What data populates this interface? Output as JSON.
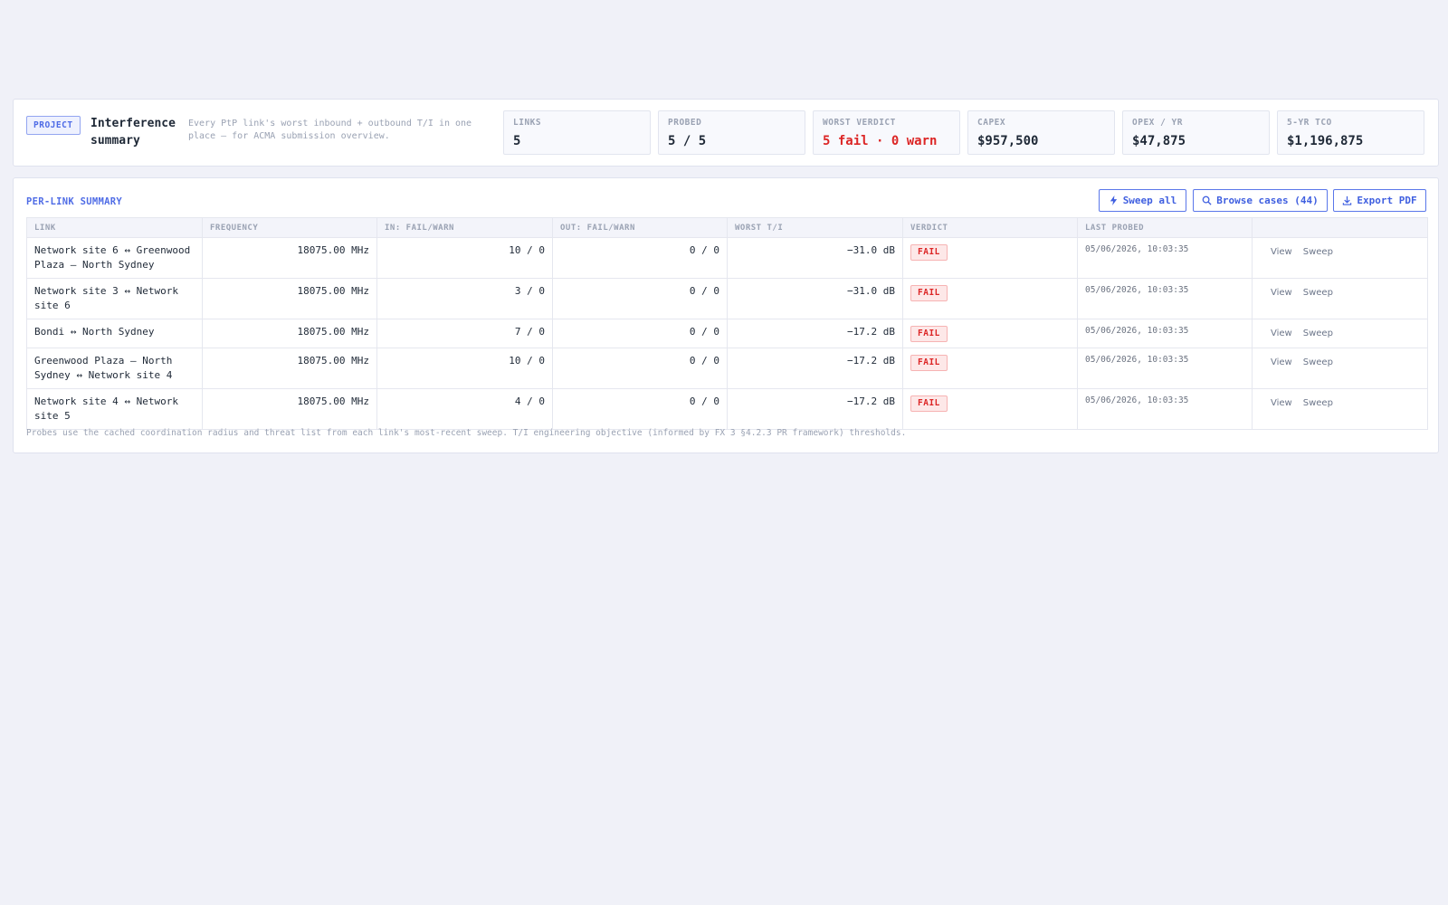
{
  "project": {
    "badge": "PROJECT",
    "title": "Interference summary",
    "description": "Every PtP link's worst inbound + outbound T/I in one place — for ACMA submission overview."
  },
  "stats": [
    {
      "label": "LINKS",
      "value": "5"
    },
    {
      "label": "PROBED",
      "value": "5 / 5"
    },
    {
      "label": "WORST VERDICT",
      "value": "5 fail · 0 warn"
    },
    {
      "label": "CAPEX",
      "value": "$957,500"
    },
    {
      "label": "OPEX / YR",
      "value": "$47,875"
    },
    {
      "label": "5-YR TCO",
      "value": "$1,196,875"
    }
  ],
  "summary": {
    "title": "PER-LINK SUMMARY",
    "buttons": {
      "sweep_all": "Sweep all",
      "browse_cases": "Browse cases (44)",
      "export_pdf": "Export PDF"
    },
    "columns": [
      "LINK",
      "FREQUENCY",
      "IN: FAIL/WARN",
      "OUT: FAIL/WARN",
      "WORST T/I",
      "VERDICT",
      "LAST PROBED",
      ""
    ],
    "rows": [
      {
        "link": "Network site 6 ↔ Greenwood Plaza — North Sydney",
        "frequency": "18075.00 MHz",
        "in": "10 / 0",
        "out": "0 / 0",
        "worst": "−31.0 dB",
        "verdict": "FAIL",
        "last_probed": "05/06/2026, 10:03:35",
        "view": "View",
        "sweep": "Sweep"
      },
      {
        "link": "Network site 3 ↔ Network site 6",
        "frequency": "18075.00 MHz",
        "in": "3 / 0",
        "out": "0 / 0",
        "worst": "−31.0 dB",
        "verdict": "FAIL",
        "last_probed": "05/06/2026, 10:03:35",
        "view": "View",
        "sweep": "Sweep"
      },
      {
        "link": "Bondi ↔ North Sydney",
        "frequency": "18075.00 MHz",
        "in": "7 / 0",
        "out": "0 / 0",
        "worst": "−17.2 dB",
        "verdict": "FAIL",
        "last_probed": "05/06/2026, 10:03:35",
        "view": "View",
        "sweep": "Sweep"
      },
      {
        "link": "Greenwood Plaza — North Sydney ↔ Network site 4",
        "frequency": "18075.00 MHz",
        "in": "10 / 0",
        "out": "0 / 0",
        "worst": "−17.2 dB",
        "verdict": "FAIL",
        "last_probed": "05/06/2026, 10:03:35",
        "view": "View",
        "sweep": "Sweep"
      },
      {
        "link": "Network site 4 ↔ Network site 5",
        "frequency": "18075.00 MHz",
        "in": "4 / 0",
        "out": "0 / 0",
        "worst": "−17.2 dB",
        "verdict": "FAIL",
        "last_probed": "05/06/2026, 10:03:35",
        "view": "View",
        "sweep": "Sweep"
      }
    ],
    "footnote": "Probes use the cached coordination radius and threat list from each link's most-recent sweep. T/I engineering objective (informed by FX 3 §4.2.3 PR framework) thresholds."
  },
  "colors": {
    "accent": "#4f6ce6",
    "fail": "#dc2626",
    "background": "#f0f1f8"
  },
  "icons": {
    "sweep_all": "lightning-icon",
    "browse_cases": "search-icon",
    "export_pdf": "download-icon"
  }
}
